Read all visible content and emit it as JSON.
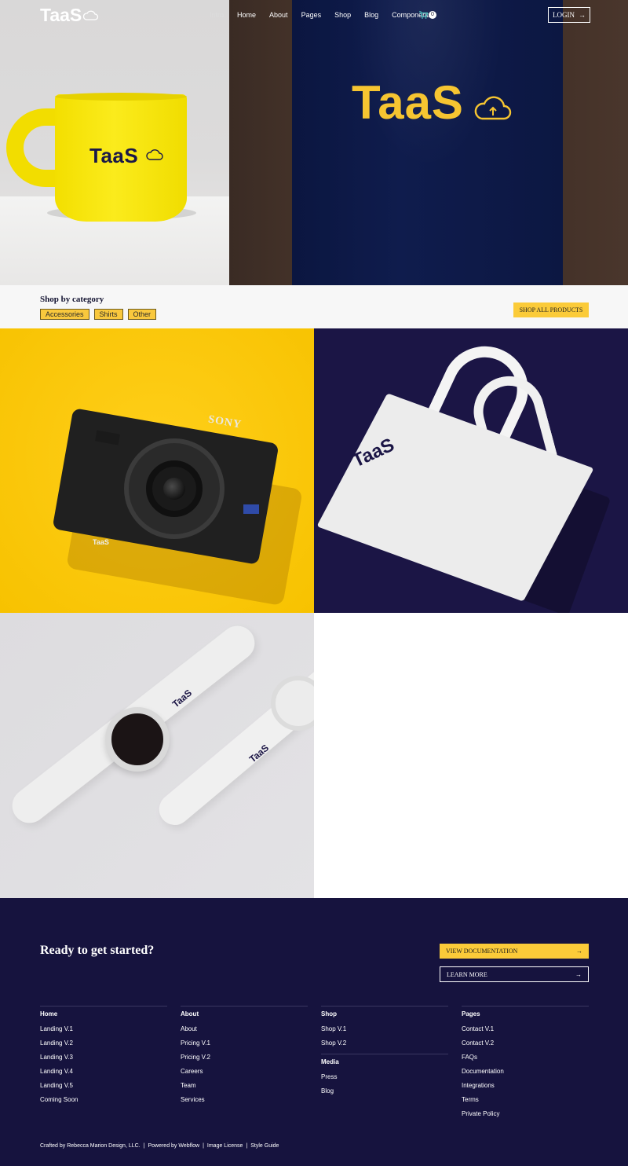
{
  "nav": {
    "brand": "TaaS",
    "links": [
      "Intro",
      "Home",
      "About",
      "Pages",
      "Shop",
      "Blog",
      "Components"
    ],
    "cart_count": "0",
    "login_label": "LOGIN",
    "login_arrow": "→"
  },
  "hero": {
    "mug_logo": "TaaS",
    "shirt_logo": "TaaS"
  },
  "category": {
    "title": "Shop by category",
    "tags": [
      "Accessories",
      "Shirts",
      "Other"
    ],
    "shop_all_label": "SHOP ALL PRODUCTS"
  },
  "products": {
    "camera_brand": "SONY",
    "camera_logo": "TaaS",
    "bag_logo": "TaaS",
    "watch_logo": "TaaS"
  },
  "footer": {
    "cta_title": "Ready to get started?",
    "docs_label": "VIEW DOCUMENTATION",
    "learn_label": "LEARN MORE",
    "arrow": "→",
    "columns": [
      {
        "heading": "Home",
        "items": [
          "Landing V.1",
          "Landing V.2",
          "Landing V.3",
          "Landing V.4",
          "Landing V.5",
          "Coming Soon"
        ]
      },
      {
        "heading": "About",
        "items": [
          "About",
          "Pricing V.1",
          "Pricing V.2",
          "Careers",
          "Team",
          "Services"
        ]
      },
      {
        "heading": "Shop",
        "items": [
          "Shop V.1",
          "Shop V.2"
        ],
        "media_heading": "Media",
        "media_items": [
          "Press",
          "Blog"
        ]
      },
      {
        "heading": "Pages",
        "items": [
          "Contact V.1",
          "Contact V.2",
          "FAQs",
          "Documentation",
          "Integrations",
          "Terms",
          "Private Policy"
        ]
      }
    ],
    "credits": [
      "Crafted by Rebecca Marion Design, LLC.",
      "Powered by Webflow",
      "Image License",
      "Style Guide"
    ],
    "credits_sep": "|"
  },
  "colors": {
    "accent": "#fbcb39",
    "navy": "#16133e",
    "category_bg": "#f7f7f7"
  }
}
